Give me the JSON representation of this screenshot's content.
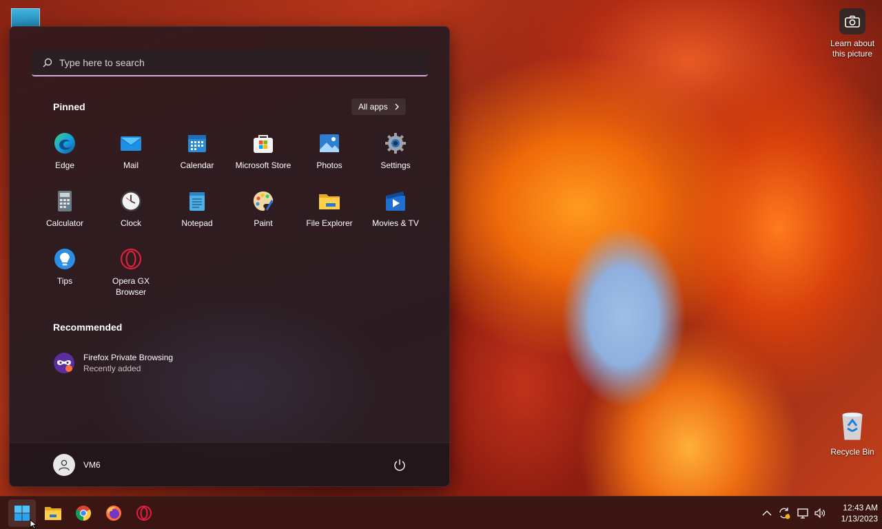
{
  "desktop": {
    "camera_widget_label": "Learn about this picture",
    "recycle_bin_label": "Recycle Bin"
  },
  "start_menu": {
    "search": {
      "placeholder": "Type here to search"
    },
    "pinned_title": "Pinned",
    "all_apps_label": "All apps",
    "pinned_apps": [
      {
        "label": "Edge",
        "icon": "edge-icon"
      },
      {
        "label": "Mail",
        "icon": "mail-icon"
      },
      {
        "label": "Calendar",
        "icon": "calendar-icon"
      },
      {
        "label": "Microsoft Store",
        "icon": "store-icon"
      },
      {
        "label": "Photos",
        "icon": "photos-icon"
      },
      {
        "label": "Settings",
        "icon": "gear-icon"
      },
      {
        "label": "Calculator",
        "icon": "calculator-icon"
      },
      {
        "label": "Clock",
        "icon": "clock-icon"
      },
      {
        "label": "Notepad",
        "icon": "notepad-icon"
      },
      {
        "label": "Paint",
        "icon": "paint-icon"
      },
      {
        "label": "File Explorer",
        "icon": "folder-icon"
      },
      {
        "label": "Movies & TV",
        "icon": "movies-icon"
      },
      {
        "label": "Tips",
        "icon": "tips-icon"
      },
      {
        "label": "Opera GX Browser",
        "icon": "opera-icon"
      }
    ],
    "recommended_title": "Recommended",
    "recommended": [
      {
        "title": "Firefox Private Browsing",
        "subtitle": "Recently added",
        "icon": "firefox-private-icon"
      }
    ],
    "user": {
      "name": "VM6"
    }
  },
  "taskbar": {
    "apps": [
      "start-icon",
      "folder-icon",
      "chrome-icon",
      "firefox-icon",
      "opera-icon"
    ],
    "time": "12:43 AM",
    "date": "1/13/2023"
  },
  "colors": {
    "accent_underline": "#d6a9d9",
    "taskbar_bg": "#3a1512",
    "menu_bg": "#2e1c20"
  }
}
